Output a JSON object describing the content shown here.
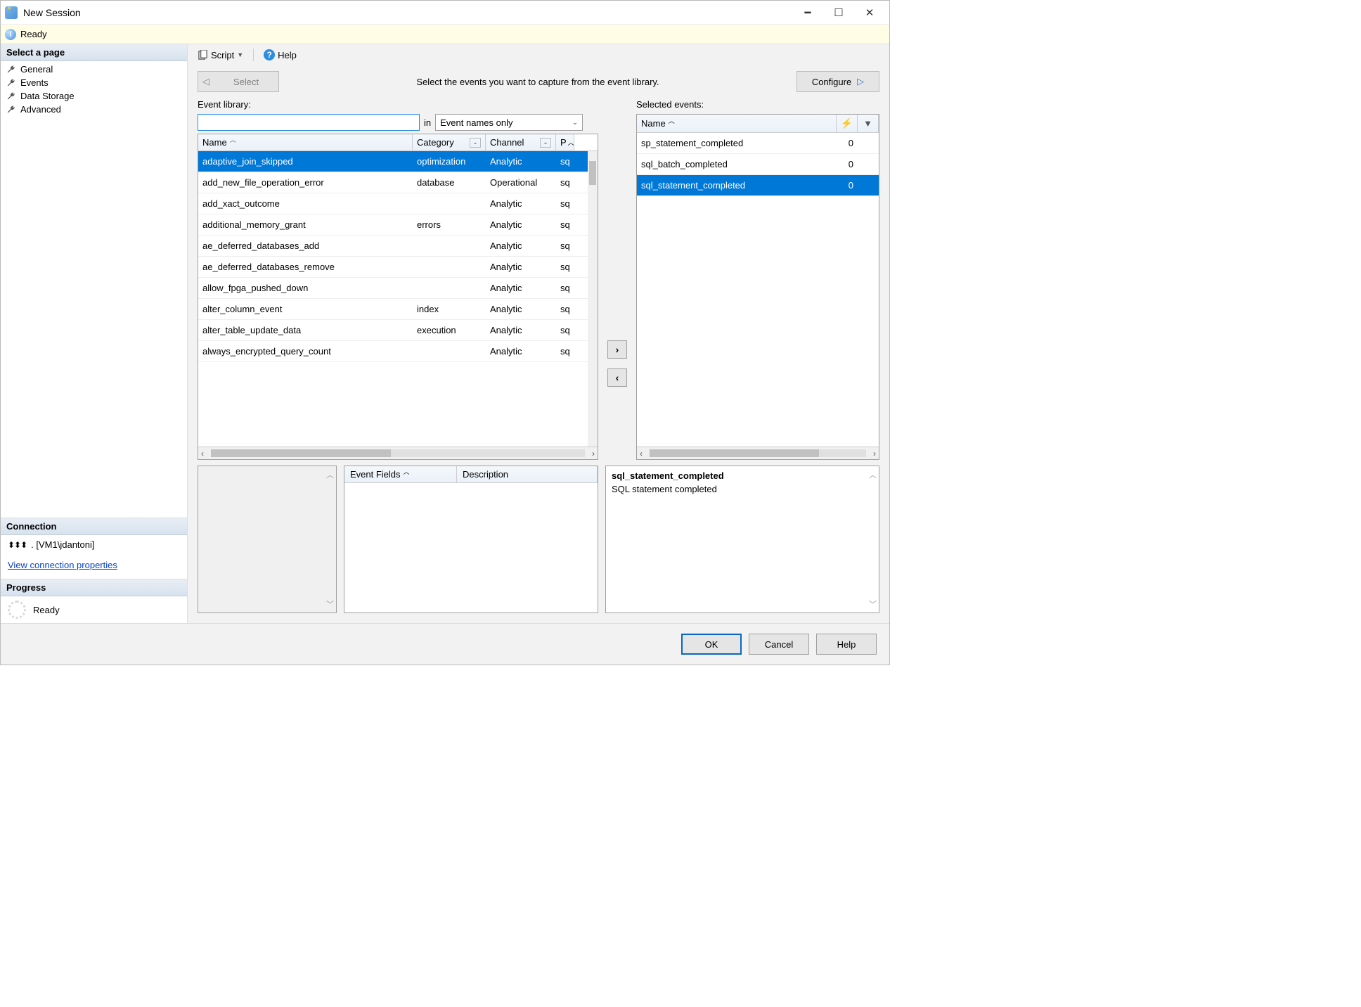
{
  "title": "New Session",
  "status": "Ready",
  "left": {
    "select_page": "Select a page",
    "pages": [
      "General",
      "Events",
      "Data Storage",
      "Advanced"
    ],
    "connection_hdr": "Connection",
    "connection": ". [VM1\\jdantoni]",
    "conn_link": "View connection properties",
    "progress_hdr": "Progress",
    "progress": "Ready"
  },
  "toolbar": {
    "script": "Script",
    "help": "Help"
  },
  "selectrow": {
    "select": "Select",
    "instr": "Select the events you want to capture from the event library.",
    "configure": "Configure"
  },
  "library": {
    "label": "Event library:",
    "search_value": "",
    "in": "in",
    "filter": "Event names only",
    "columns": {
      "name": "Name",
      "category": "Category",
      "channel": "Channel",
      "p": "P"
    },
    "rows": [
      {
        "name": "adaptive_join_skipped",
        "category": "optimization",
        "channel": "Analytic",
        "p": "sq",
        "selected": true
      },
      {
        "name": "add_new_file_operation_error",
        "category": "database",
        "channel": "Operational",
        "p": "sq"
      },
      {
        "name": "add_xact_outcome",
        "category": "",
        "channel": "Analytic",
        "p": "sq"
      },
      {
        "name": "additional_memory_grant",
        "category": "errors",
        "channel": "Analytic",
        "p": "sq"
      },
      {
        "name": "ae_deferred_databases_add",
        "category": "",
        "channel": "Analytic",
        "p": "sq"
      },
      {
        "name": "ae_deferred_databases_remove",
        "category": "",
        "channel": "Analytic",
        "p": "sq"
      },
      {
        "name": "allow_fpga_pushed_down",
        "category": "",
        "channel": "Analytic",
        "p": "sq"
      },
      {
        "name": "alter_column_event",
        "category": "index",
        "channel": "Analytic",
        "p": "sq"
      },
      {
        "name": "alter_table_update_data",
        "category": "execution",
        "channel": "Analytic",
        "p": "sq"
      },
      {
        "name": "always_encrypted_query_count",
        "category": "",
        "channel": "Analytic",
        "p": "sq"
      }
    ]
  },
  "selected": {
    "label": "Selected events:",
    "columns": {
      "name": "Name"
    },
    "rows": [
      {
        "name": "sp_statement_completed",
        "count": "0"
      },
      {
        "name": "sql_batch_completed",
        "count": "0"
      },
      {
        "name": "sql_statement_completed",
        "count": "0",
        "selected": true
      }
    ]
  },
  "details": {
    "eventfields": "Event Fields",
    "description": "Description",
    "title": "sql_statement_completed",
    "desc": "SQL statement completed"
  },
  "buttons": {
    "ok": "OK",
    "cancel": "Cancel",
    "help": "Help"
  }
}
